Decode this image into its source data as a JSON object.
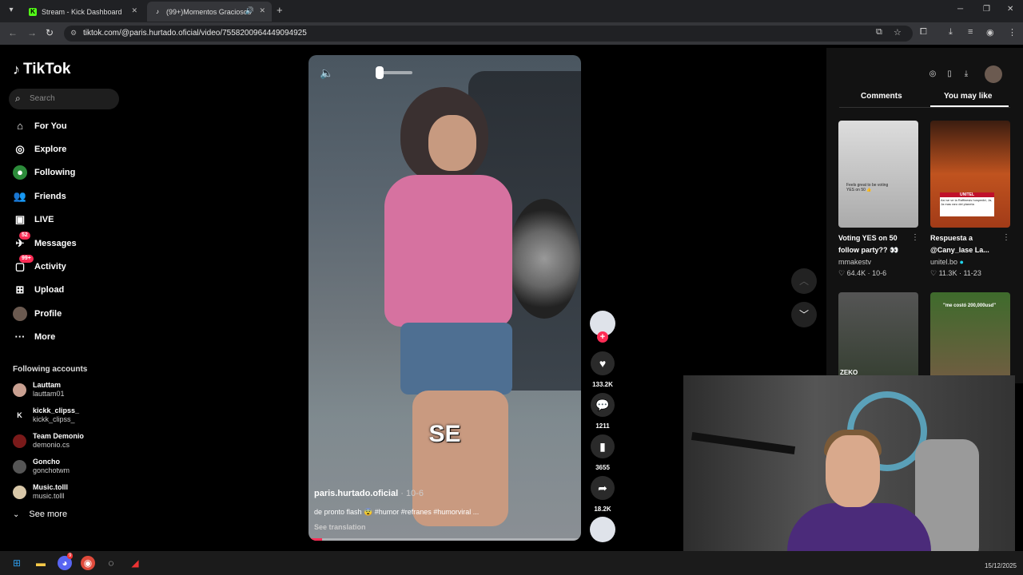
{
  "browser": {
    "tabs": [
      {
        "title": "Stream - Kick Dashboard",
        "icon": "kick-icon",
        "color": "#53fc18"
      },
      {
        "title": "(99+)Momentos Graciosos",
        "icon": "tiktok-icon",
        "active": true
      }
    ],
    "url": "tiktok.com/@paris.hurtado.oficial/video/7558200964449094925"
  },
  "sidebar": {
    "logo": "TikTok",
    "search_placeholder": "Search",
    "nav": [
      {
        "label": "For You",
        "icon": "home-icon"
      },
      {
        "label": "Explore",
        "icon": "compass-icon"
      },
      {
        "label": "Following",
        "icon": "following-icon"
      },
      {
        "label": "Friends",
        "icon": "friends-icon"
      },
      {
        "label": "LIVE",
        "icon": "live-icon"
      },
      {
        "label": "Messages",
        "icon": "messages-icon",
        "badge": "52"
      },
      {
        "label": "Activity",
        "icon": "activity-icon",
        "badge": "99+"
      },
      {
        "label": "Upload",
        "icon": "upload-icon"
      },
      {
        "label": "Profile",
        "icon": "profile-icon"
      },
      {
        "label": "More",
        "icon": "more-icon"
      }
    ],
    "following_header": "Following accounts",
    "accounts": [
      {
        "name": "Lauttam",
        "user": "lauttam01"
      },
      {
        "name": "kickk_clipss_",
        "user": "kickk_clipss_"
      },
      {
        "name": "Team Demonio",
        "user": "demonio.cs"
      },
      {
        "name": "Goncho",
        "user": "gonchotwm"
      },
      {
        "name": "Music.tolll",
        "user": "music.tolll"
      }
    ],
    "see_more": "See more"
  },
  "video": {
    "caption_overlay": "SE",
    "author": "paris.hurtado.oficial",
    "date": "10-6",
    "description": "de pronto flash 😨 #humor #refranes #humorviral ...",
    "see_translation": "See translation",
    "progress": 0.05
  },
  "actions": {
    "likes": "133.2K",
    "comments": "1211",
    "saves": "3655",
    "shares": "18.2K"
  },
  "right_panel": {
    "tabs": [
      "Comments",
      "You may like"
    ],
    "videos": [
      {
        "title": "Voting YES on 50 follow party?? 👀",
        "user": "mmakestv",
        "likes": "64.4K",
        "date": "10-6"
      },
      {
        "title": "Respuesta a @Cany_lase La...",
        "user": "unitel.bo",
        "likes": "11.3K",
        "date": "11-23"
      }
    ],
    "thumb_text": {
      "t1": "Feels great to be voting YES on 50 👍",
      "t2a": "UNITEL",
      "t2b": "Así se ve la Raffinesis hospedid, Ja, Ja mas raro del planeta",
      "t3": "ZEKO",
      "t4": "\"me costó 200,000usd\""
    }
  },
  "taskbar": {
    "date": "15/12/2025",
    "discord_badge": "9"
  }
}
